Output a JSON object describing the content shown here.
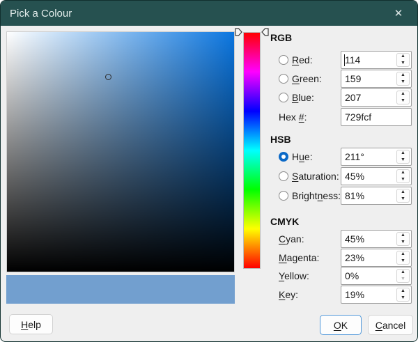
{
  "window": {
    "title": "Pick a Colour"
  },
  "icons": {
    "close": "✕",
    "spin_up": "▲",
    "spin_down": "▼"
  },
  "picker": {
    "preview_color": "#729fcf"
  },
  "rgb": {
    "header": "RGB",
    "rows": [
      {
        "pre": "",
        "key": "R",
        "post": "ed:",
        "value": "114"
      },
      {
        "pre": "",
        "key": "G",
        "post": "reen:",
        "value": "159"
      },
      {
        "pre": "",
        "key": "B",
        "post": "lue:",
        "value": "207"
      }
    ],
    "hex": {
      "pre": "Hex ",
      "key": "#",
      "post": ":",
      "value": "729fcf"
    }
  },
  "hsb": {
    "header": "HSB",
    "rows": [
      {
        "pre": "H",
        "key": "u",
        "post": "e:",
        "value": "211°",
        "selected": true
      },
      {
        "pre": "",
        "key": "S",
        "post": "aturation:",
        "value": "45%"
      },
      {
        "pre": "Bright",
        "key": "n",
        "post": "ess:",
        "value": "81%"
      }
    ]
  },
  "cmyk": {
    "header": "CMYK",
    "rows": [
      {
        "pre": "",
        "key": "C",
        "post": "yan:",
        "value": "45%"
      },
      {
        "pre": "",
        "key": "M",
        "post": "agenta:",
        "value": "23%"
      },
      {
        "pre": "",
        "key": "Y",
        "post": "ellow:",
        "value": "0%",
        "down_disabled": true
      },
      {
        "pre": "",
        "key": "K",
        "post": "ey:",
        "value": "19%"
      }
    ]
  },
  "buttons": {
    "help": {
      "pre": "",
      "key": "H",
      "post": "elp"
    },
    "ok": {
      "pre": "",
      "key": "O",
      "post": "K"
    },
    "cancel": {
      "pre": "",
      "key": "C",
      "post": "ancel"
    }
  }
}
